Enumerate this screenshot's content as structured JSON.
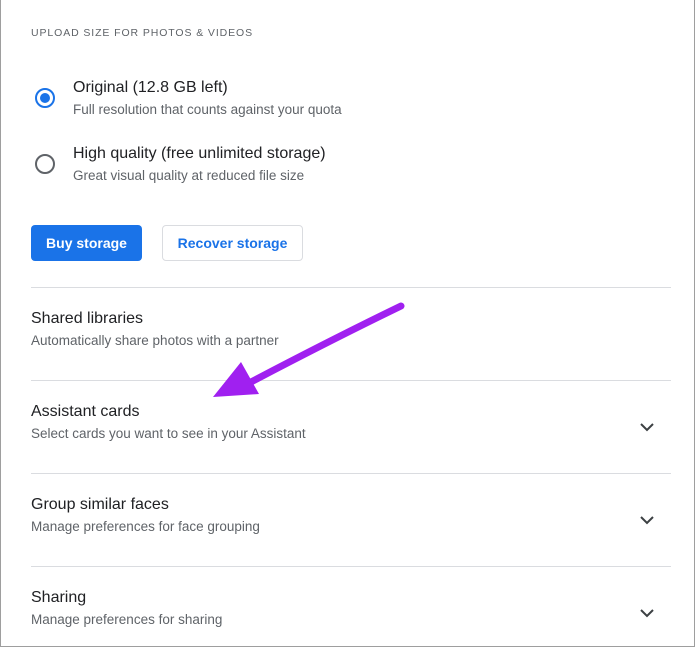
{
  "upload": {
    "section_label": "UPLOAD SIZE FOR PHOTOS & VIDEOS",
    "options": [
      {
        "title": "Original (12.8 GB left)",
        "subtitle": "Full resolution that counts against your quota",
        "selected": true
      },
      {
        "title": "High quality (free unlimited storage)",
        "subtitle": "Great visual quality at reduced file size",
        "selected": false
      }
    ],
    "buy_label": "Buy storage",
    "recover_label": "Recover storage"
  },
  "settings": [
    {
      "title": "Shared libraries",
      "subtitle": "Automatically share photos with a partner",
      "expandable": false
    },
    {
      "title": "Assistant cards",
      "subtitle": "Select cards you want to see in your Assistant",
      "expandable": true
    },
    {
      "title": "Group similar faces",
      "subtitle": "Manage preferences for face grouping",
      "expandable": true
    },
    {
      "title": "Sharing",
      "subtitle": "Manage preferences for sharing",
      "expandable": true
    }
  ],
  "colors": {
    "accent": "#1a73e8",
    "annotation_arrow": "#a020f0"
  },
  "icons": {
    "chevron": "chevron-down-icon",
    "annotation": "annotation-arrow-icon"
  }
}
